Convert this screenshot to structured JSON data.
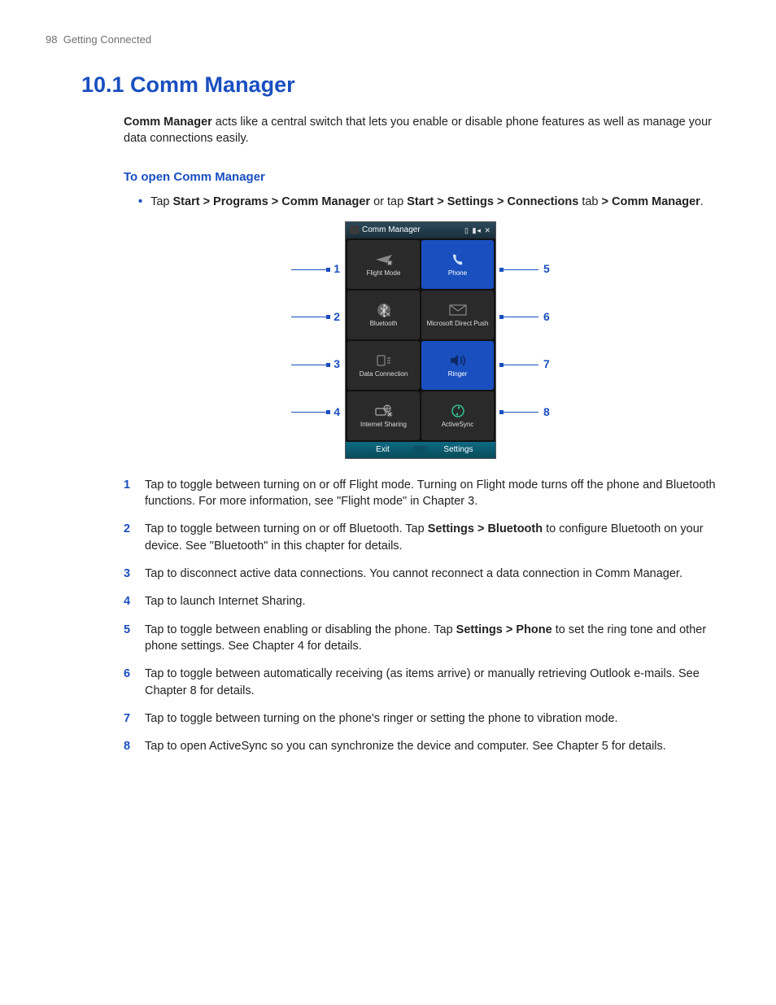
{
  "header": {
    "page_number": "98",
    "chapter": "Getting Connected"
  },
  "section": {
    "title": "10.1  Comm Manager"
  },
  "intro": {
    "lead_bold": "Comm Manager",
    "text": " acts like a central switch that lets you enable or disable phone features as well as manage your data connections easily."
  },
  "subhead": "To open Comm Manager",
  "bullet": {
    "pre": "Tap ",
    "path1": "Start > Programs > Comm Manager",
    "mid": " or tap ",
    "path2a": "Start > Settings > Connections",
    "tab_word": " tab ",
    "path2b": "> Comm Manager",
    "post": "."
  },
  "callouts_left": [
    "1",
    "2",
    "3",
    "4"
  ],
  "callouts_right": [
    "5",
    "6",
    "7",
    "8"
  ],
  "phone": {
    "title": "Comm Manager",
    "tiles": [
      {
        "label": "Flight Mode"
      },
      {
        "label": "Phone"
      },
      {
        "label": "Bluetooth"
      },
      {
        "label": "Microsoft Direct Push"
      },
      {
        "label": "Data Connection"
      },
      {
        "label": "Ringer"
      },
      {
        "label": "Internet Sharing"
      },
      {
        "label": "ActiveSync"
      }
    ],
    "softkeys": {
      "left": "Exit",
      "right": "Settings"
    }
  },
  "items": [
    {
      "n": "1",
      "parts": [
        {
          "t": "Tap to toggle between turning on or off Flight mode. Turning on Flight mode turns off the phone and Bluetooth functions. For more information, see \"Flight mode\" in Chapter 3."
        }
      ]
    },
    {
      "n": "2",
      "parts": [
        {
          "t": "Tap to toggle between turning on or off Bluetooth. Tap "
        },
        {
          "b": "Settings > Bluetooth"
        },
        {
          "t": " to configure Bluetooth on your device. See \"Bluetooth\" in this chapter for details."
        }
      ]
    },
    {
      "n": "3",
      "parts": [
        {
          "t": "Tap to disconnect active data connections. You cannot reconnect a data connection in Comm Manager."
        }
      ]
    },
    {
      "n": "4",
      "parts": [
        {
          "t": "Tap to launch Internet Sharing."
        }
      ]
    },
    {
      "n": "5",
      "parts": [
        {
          "t": "Tap to toggle between enabling or disabling the phone. Tap "
        },
        {
          "b": "Settings > Phone"
        },
        {
          "t": " to set the ring tone and other phone settings. See Chapter 4 for details."
        }
      ]
    },
    {
      "n": "6",
      "parts": [
        {
          "t": "Tap to toggle between automatically receiving (as items arrive) or manually retrieving Outlook e-mails. See Chapter 8 for details."
        }
      ]
    },
    {
      "n": "7",
      "parts": [
        {
          "t": "Tap to toggle between turning on the phone's ringer or setting the phone to vibration mode."
        }
      ]
    },
    {
      "n": "8",
      "parts": [
        {
          "t": "Tap to open ActiveSync so you can synchronize the device and computer. See Chapter 5 for details."
        }
      ]
    }
  ]
}
